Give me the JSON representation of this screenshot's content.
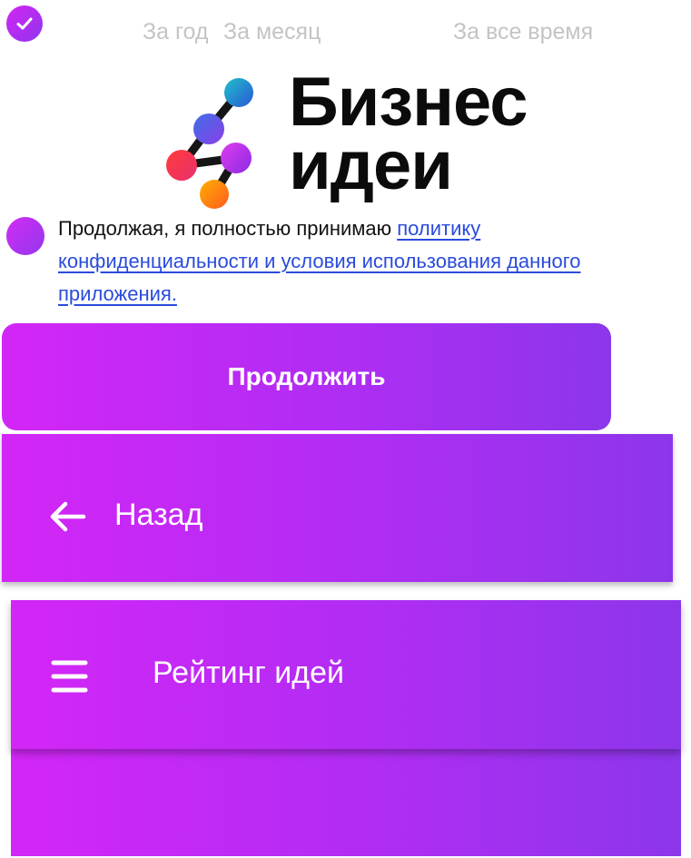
{
  "tabs": [
    {
      "label": "За год"
    },
    {
      "label": "За месяц"
    },
    {
      "label": "За все время"
    }
  ],
  "brand": {
    "line1": "Бизнес",
    "line2": "идеи"
  },
  "consent": {
    "prefix": "Продолжая, я полностью принимаю ",
    "link": "политику конфиденциальности и условия использования данного приложения."
  },
  "continue_button": {
    "label": "Продолжить"
  },
  "back_bar": {
    "label": "Назад"
  },
  "rating_bar": {
    "title": "Рейтинг идей"
  },
  "colors": {
    "accent_start": "#d326f7",
    "accent_end": "#8c36ea",
    "link": "#2a4bdc",
    "tab_inactive": "#c4c4c4"
  },
  "icons": {
    "check": "check-icon",
    "back": "arrow-left-icon",
    "menu": "hamburger-menu-icon"
  }
}
